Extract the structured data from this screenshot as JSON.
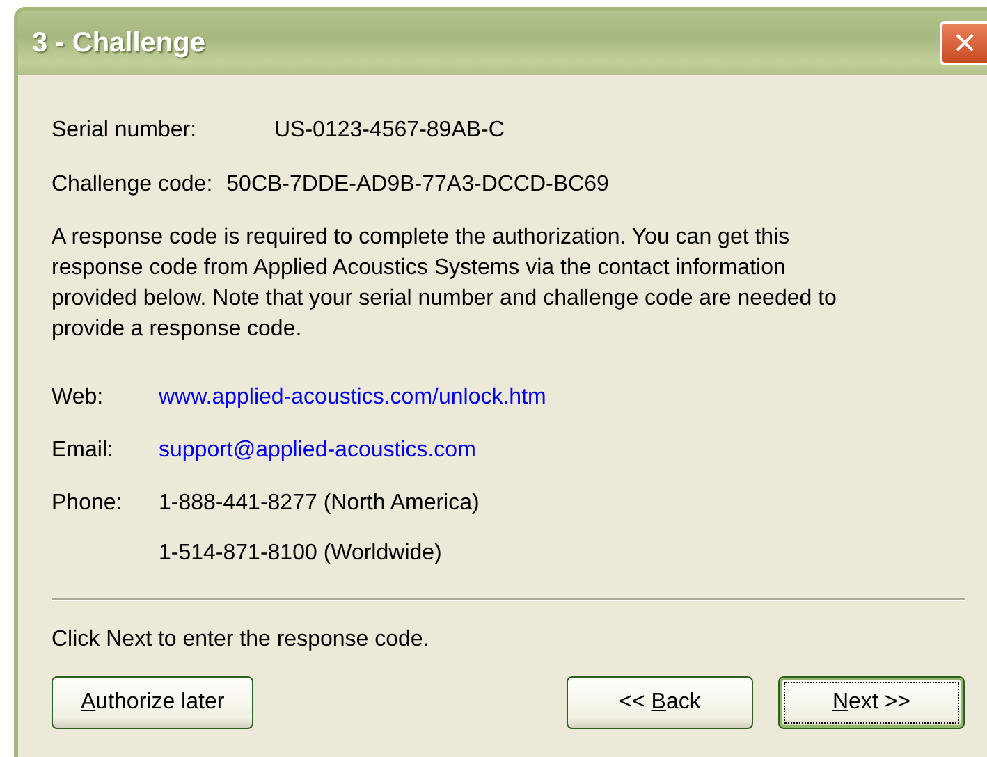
{
  "window": {
    "title": "3 - Challenge",
    "close": "×"
  },
  "fields": [
    {
      "label": "Serial number:",
      "value": "US-0123-4567-89AB-C"
    },
    {
      "label": "Challenge code:",
      "value": "50CB-7DDE-AD9B-77A3-DCCD-BC69"
    }
  ],
  "message": "A response code is required to complete the authorization. You can get this response code from Applied Acoustics Systems via the contact information provided below. Note that your serial number and challenge code are needed to provide a response code.",
  "contacts": [
    {
      "label": "Web:",
      "kind": "link",
      "values": [
        "www.applied-acoustics.com/unlock.htm"
      ]
    },
    {
      "label": "Email:",
      "kind": "link",
      "values": [
        "support@applied-acoustics.com"
      ]
    },
    {
      "label": "Phone:",
      "kind": "text",
      "values": [
        "1-888-441-8277 (North America)",
        "1-514-871-8100 (Worldwide)"
      ]
    }
  ],
  "instruction": "Click Next to enter the response code.",
  "buttons": [
    {
      "key": "A",
      "after": "uthorize later",
      "default": false
    },
    {
      "before": "<< ",
      "key": "B",
      "after": "ack",
      "default": false
    },
    {
      "key": "N",
      "after": "ext >>",
      "default": true
    }
  ]
}
